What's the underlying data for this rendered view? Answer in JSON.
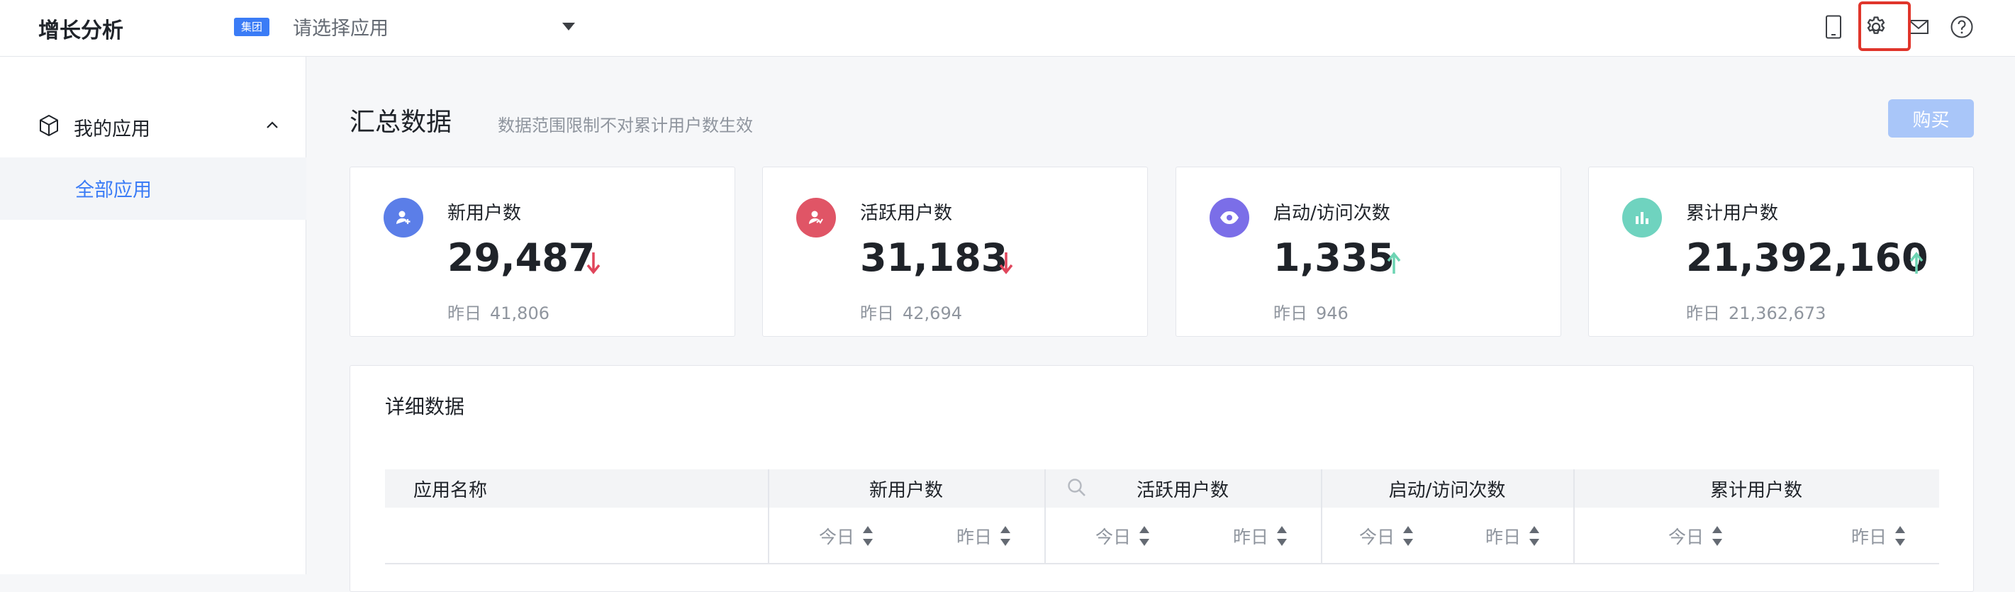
{
  "header": {
    "app_title": "增长分析",
    "group_badge": "集团",
    "app_select_placeholder": "请选择应用",
    "icons": [
      "mobile-icon",
      "gear-icon",
      "mail-icon",
      "help-icon"
    ]
  },
  "sidebar": {
    "group_label": "我的应用",
    "items": [
      {
        "label": "全部应用",
        "active": true
      }
    ]
  },
  "main": {
    "title": "汇总数据",
    "subtitle": "数据范围限制不对累计用户数生效",
    "buy_button": "购买",
    "cards": [
      {
        "label": "新用户数",
        "value": "29,487",
        "trend": "down",
        "prev_label": "昨日",
        "prev_value": "41,806",
        "icon_color": "#5b7ee8"
      },
      {
        "label": "活跃用户数",
        "value": "31,183",
        "trend": "down",
        "prev_label": "昨日",
        "prev_value": "42,694",
        "icon_color": "#e05566"
      },
      {
        "label": "启动/访问次数",
        "value": "1,335",
        "trend": "up",
        "prev_label": "昨日",
        "prev_value": "946",
        "icon_color": "#7b6ee8"
      },
      {
        "label": "累计用户数",
        "value": "21,392,160",
        "trend": "up",
        "prev_label": "昨日",
        "prev_value": "21,362,673",
        "icon_color": "#6fd3bf"
      }
    ]
  },
  "detail": {
    "title": "详细数据",
    "columns": [
      "应用名称",
      "新用户数",
      "活跃用户数",
      "启动/访问次数",
      "累计用户数"
    ],
    "sub_columns": [
      "今日",
      "昨日"
    ]
  },
  "colors": {
    "accent": "#3b7cf6",
    "trend_down": "#e0455b",
    "trend_up": "#6dd4b3",
    "highlight": "#e0352b"
  }
}
